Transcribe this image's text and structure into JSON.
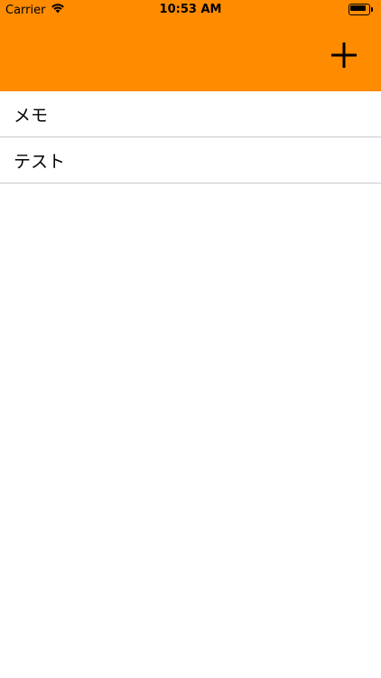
{
  "status_bar": {
    "carrier": "Carrier",
    "wifi_icon": "wifi-icon",
    "time": "10:53 AM",
    "battery_icon": "battery-icon",
    "battery_level": 0.85
  },
  "header": {
    "background_color": "#FF8C00",
    "add_icon": "plus-icon"
  },
  "list": {
    "items": [
      {
        "label": "メモ"
      },
      {
        "label": "テスト"
      }
    ]
  }
}
